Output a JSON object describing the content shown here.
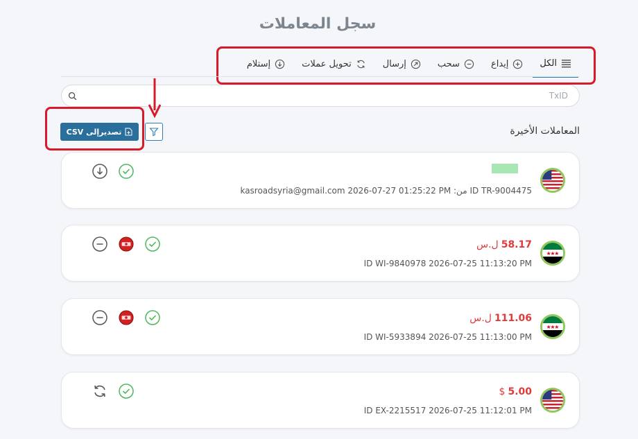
{
  "page": {
    "title": "سجل المعاملات"
  },
  "tabs": [
    {
      "label": "الكل",
      "icon": "list-icon",
      "active": true
    },
    {
      "label": "إيداع",
      "icon": "plus-circle-icon",
      "active": false
    },
    {
      "label": "سحب",
      "icon": "minus-circle-icon",
      "active": false
    },
    {
      "label": "إرسال",
      "icon": "send-arrow-icon",
      "active": false
    },
    {
      "label": "تحويل عملات",
      "icon": "refresh-icon",
      "active": false
    },
    {
      "label": "إستلام",
      "icon": "download-circle-icon",
      "active": false
    }
  ],
  "search": {
    "placeholder": "TxID",
    "value": ""
  },
  "section": {
    "title": "المعاملات الأخيرة"
  },
  "toolbar": {
    "export_label": "تصديرإلى CSV"
  },
  "colors": {
    "accent": "#2a6f9c",
    "annotation_red": "#d8192a",
    "success_green": "#4cb85c",
    "amount_red": "#e03a3a"
  },
  "transactions": [
    {
      "flag": "us-flag",
      "amount": "",
      "currency": "",
      "meta": "ID TR-9004475 من: kasroadsyria@gmail.com 2026-07-27 01:25:22 PM",
      "type_icon": "download-circle-icon",
      "status_icon": "check-circle-icon"
    },
    {
      "flag": "syria-flag",
      "amount": "58.17",
      "currency": "ل.س",
      "meta": "ID WI-9840978 2026-07-25 11:13:20 PM",
      "type_icon": "minus-circle-icon",
      "status_icon": "check-circle-icon"
    },
    {
      "flag": "syria-flag",
      "amount": "111.06",
      "currency": "ل.س",
      "meta": "ID WI-5933894 2026-07-25 11:13:00 PM",
      "type_icon": "minus-circle-icon",
      "status_icon": "check-circle-icon"
    },
    {
      "flag": "us-flag",
      "amount": "5.00",
      "currency": "$",
      "meta": "ID EX-2215517 2026-07-25 11:12:01 PM",
      "type_icon": "refresh-icon",
      "status_icon": "check-circle-icon"
    }
  ]
}
